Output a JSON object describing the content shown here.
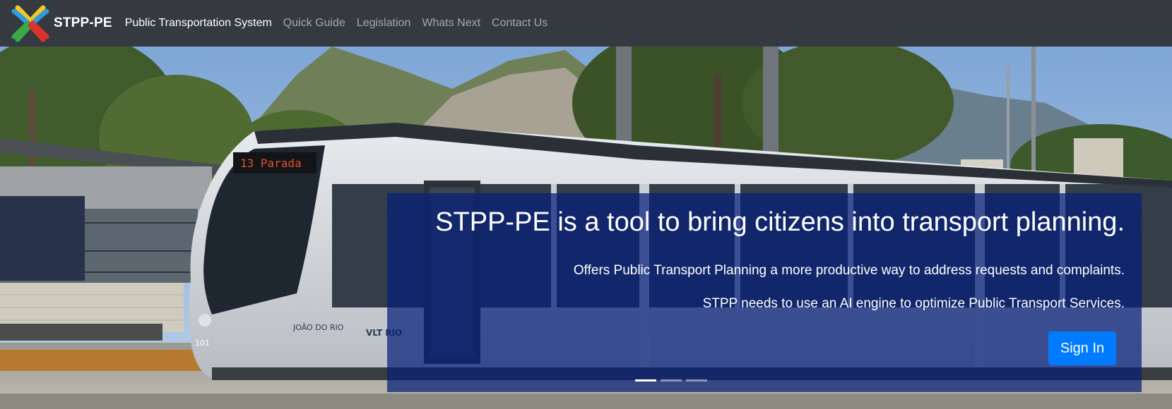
{
  "navbar": {
    "brand": {
      "name": "STPP-PE",
      "logo_icon": "x-star-logo-icon",
      "logo_colors": [
        "#f3c623",
        "#2e9be0",
        "#d9342b",
        "#3aa845"
      ]
    },
    "links": [
      {
        "label": "Public Transportation System",
        "active": true
      },
      {
        "label": "Quick Guide",
        "active": false
      },
      {
        "label": "Legislation",
        "active": false
      },
      {
        "label": "Whats Next",
        "active": false
      },
      {
        "label": "Contact Us",
        "active": false
      }
    ]
  },
  "hero": {
    "image": "tram-vlt-rio-photo",
    "headline": "STPP-PE is a tool to bring citizens into transport planning.",
    "lines": [
      "Offers Public Transport Planning a more productive way to address requests and complaints.",
      "STPP needs to use an AI engine to optimize Public Transport Services."
    ],
    "sign_in_label": "Sign In",
    "slide_count": 3,
    "active_slide": 1,
    "tram": {
      "destination_sign": "13  Parada",
      "fleet_number": "101",
      "name_lettering": "JOÃO DO RIO",
      "operator_lettering": "VLT RIO"
    }
  },
  "colors": {
    "navbar_bg": "#343a40",
    "primary": "#007bff",
    "caption_panel": "#061e78"
  }
}
